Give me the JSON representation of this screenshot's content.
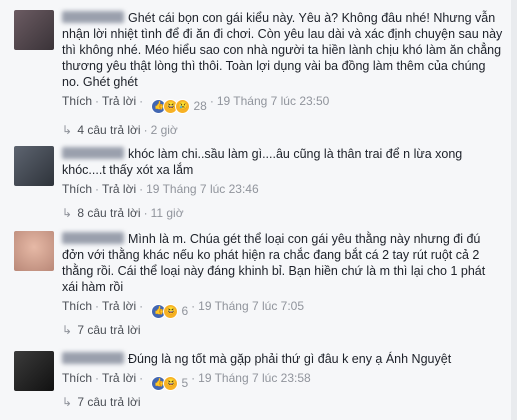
{
  "comments": [
    {
      "text": "Ghét cái bọn con gái kiểu này. Yêu à? Không đâu nhé! Nhưng vẫn nhận lời nhiệt tình để đi ăn đi chơi. Còn yêu lau dài và xác định chuyện sau này thì không nhé. Méo hiểu sao con nhà người ta hiền lành chịu khó làm ăn chẳng thương yêu thật lòng thì thôi. Toàn lợi dụng vài ba đồng làm thêm của chúng no. Ghét ghét",
      "like": "Thích",
      "reply": "Trả lời",
      "reaction_count": "28",
      "time": "19 Tháng 7 lúc 23:50",
      "replies_label": "4 câu trả lời",
      "replies_time": "2 giờ"
    },
    {
      "text": "khóc làm chi..sầu làm gì....âu cũng là thân trai để n lừa xong khóc....t thấy xót xa lắm",
      "like": "Thích",
      "reply": "Trả lời",
      "time": "19 Tháng 7 lúc 23:46",
      "replies_label": "8 câu trả lời",
      "replies_time": "11 giờ"
    },
    {
      "text": "Mình là m. Chúa gét thể loại con gái yêu thằng này nhưng đi đú đởn với thằng khác nếu ko phát hiện ra chắc đang bắt cá 2 tay rút ruột cả 2 thằng rồi. Cái thể loại này đáng khinh bỉ. Bạn hiền chứ là m thì lại cho 1 phát xái hàm rồi",
      "like": "Thích",
      "reply": "Trả lời",
      "reaction_count": "6",
      "time": "19 Tháng 7 lúc 7:05",
      "replies_label": "7 câu trả lời"
    },
    {
      "text": "Đúng là ng tốt mà gặp phải thứ gì đâu k eny ạ Ánh Nguyệt",
      "like": "Thích",
      "reply": "Trả lời",
      "reaction_count": "5",
      "time": "19 Tháng 7 lúc 23:58",
      "replies_label": "7 câu trả lời"
    }
  ],
  "icons": {
    "like": "like-icon",
    "haha": "haha-icon",
    "sad": "sad-icon",
    "replies": "reply-arrow-icon"
  },
  "colors": {
    "link": "#4b4f56",
    "meta": "#90949c",
    "like": "#4267b2",
    "emoji": "#f7b125"
  }
}
